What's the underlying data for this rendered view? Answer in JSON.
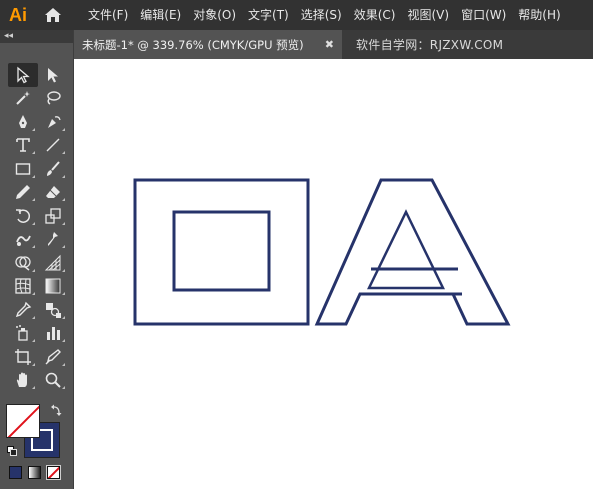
{
  "app": {
    "logo_text": "Ai",
    "brand_color": "#ff9a00"
  },
  "menu": {
    "items": [
      "文件(F)",
      "编辑(E)",
      "对象(O)",
      "文字(T)",
      "选择(S)",
      "效果(C)",
      "视图(V)",
      "窗口(W)",
      "帮助(H)"
    ]
  },
  "tab": {
    "title": "未标题-1* @ 339.76% (CMYK/GPU 预览)",
    "close_glyph": "✖",
    "watermark": "软件自学网：RJZXW.COM"
  },
  "toolbar": {
    "collapse_glyph": "◂◂",
    "tools": [
      {
        "name": "selection-tool",
        "icon": "selection-arrow-icon"
      },
      {
        "name": "direct-selection-tool",
        "icon": "direct-selection-arrow-icon"
      },
      {
        "name": "magic-wand-tool",
        "icon": "magic-wand-icon"
      },
      {
        "name": "lasso-tool",
        "icon": "lasso-icon"
      },
      {
        "name": "pen-tool",
        "icon": "pen-icon"
      },
      {
        "name": "curvature-tool",
        "icon": "curvature-pen-icon"
      },
      {
        "name": "type-tool",
        "icon": "type-icon"
      },
      {
        "name": "line-segment-tool",
        "icon": "line-segment-icon"
      },
      {
        "name": "rectangle-tool",
        "icon": "rectangle-icon"
      },
      {
        "name": "paintbrush-tool",
        "icon": "paintbrush-icon"
      },
      {
        "name": "pencil-tool",
        "icon": "pencil-icon"
      },
      {
        "name": "eraser-tool",
        "icon": "eraser-icon"
      },
      {
        "name": "rotate-tool",
        "icon": "rotate-icon"
      },
      {
        "name": "scale-tool",
        "icon": "scale-icon"
      },
      {
        "name": "warp-tool",
        "icon": "warp-icon"
      },
      {
        "name": "puppet-warp-tool",
        "icon": "puppet-warp-icon"
      },
      {
        "name": "shape-builder-tool",
        "icon": "shape-builder-icon"
      },
      {
        "name": "perspective-grid-tool",
        "icon": "perspective-grid-icon"
      },
      {
        "name": "mesh-tool",
        "icon": "mesh-icon"
      },
      {
        "name": "gradient-tool",
        "icon": "gradient-icon"
      },
      {
        "name": "eyedropper-tool",
        "icon": "eyedropper-icon"
      },
      {
        "name": "blend-tool",
        "icon": "blend-icon"
      },
      {
        "name": "symbol-sprayer-tool",
        "icon": "symbol-sprayer-icon"
      },
      {
        "name": "column-graph-tool",
        "icon": "column-graph-icon"
      },
      {
        "name": "artboard-tool",
        "icon": "artboard-icon"
      },
      {
        "name": "slice-tool",
        "icon": "slice-icon"
      },
      {
        "name": "hand-tool",
        "icon": "hand-icon"
      },
      {
        "name": "zoom-tool",
        "icon": "zoom-icon"
      }
    ],
    "fill": {
      "state": "none",
      "color": "#ffffff",
      "none_line_color": "#e0121b"
    },
    "stroke": {
      "color": "#26336a"
    }
  },
  "artwork": {
    "stroke_color": "#26336a",
    "background": "#ffffff"
  }
}
